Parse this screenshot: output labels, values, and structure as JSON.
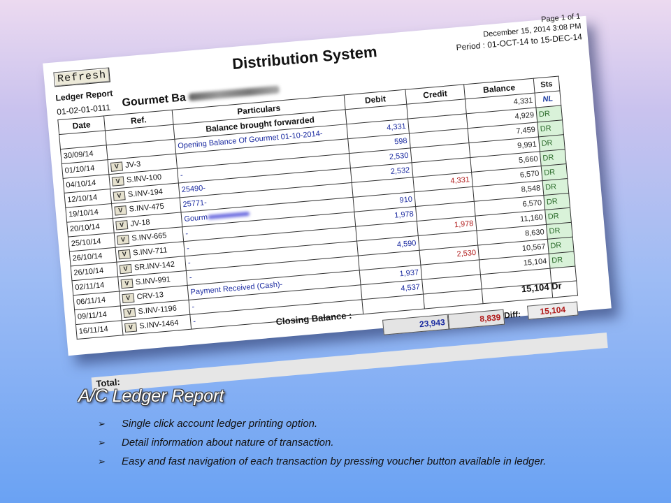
{
  "report": {
    "refresh_label": "Refresh",
    "title": "Distribution System",
    "page": "Page 1 of 1",
    "printed": "December 15, 2014 3:08 PM",
    "period": "Period : 01-OCT-14 to 15-DEC-14",
    "report_label": "Ledger Report",
    "account_code": "01-02-01-0111",
    "account_name": "Gourmet Ba",
    "columns": {
      "date": "Date",
      "ref": "Ref.",
      "particulars": "Particulars",
      "debit": "Debit",
      "credit": "Credit",
      "balance": "Balance",
      "sts": "Sts"
    },
    "opening": {
      "particulars": "Balance brought forwarded",
      "sts": "NL",
      "balance": "4,331",
      "sts2": "DR"
    },
    "rows": [
      {
        "date": "30/09/14",
        "voucher": "",
        "ref": "",
        "particulars": "Opening Balance Of Gourmet 01-10-2014-",
        "debit": "4,331",
        "credit": "",
        "balance": "4,929",
        "sts": "DR"
      },
      {
        "date": "01/10/14",
        "voucher": "V",
        "ref": "JV-3",
        "particulars": "",
        "debit": "598",
        "credit": "",
        "balance": "7,459",
        "sts": "DR"
      },
      {
        "date": "04/10/14",
        "voucher": "V",
        "ref": "S.INV-100",
        "particulars": "-",
        "debit": "2,530",
        "credit": "",
        "balance": "9,991",
        "sts": "DR"
      },
      {
        "date": "12/10/14",
        "voucher": "V",
        "ref": "S.INV-194",
        "particulars": "25490-",
        "debit": "2,532",
        "credit": "",
        "balance": "5,660",
        "sts": "DR"
      },
      {
        "date": "19/10/14",
        "voucher": "V",
        "ref": "S.INV-475",
        "particulars": "25771-",
        "debit": "",
        "credit": "4,331",
        "balance": "6,570",
        "sts": "DR"
      },
      {
        "date": "20/10/14",
        "voucher": "V",
        "ref": "JV-18",
        "particulars": "Gourm",
        "debit": "910",
        "credit": "",
        "balance": "8,548",
        "sts": "DR"
      },
      {
        "date": "25/10/14",
        "voucher": "V",
        "ref": "S.INV-665",
        "particulars": "-",
        "debit": "1,978",
        "credit": "",
        "balance": "6,570",
        "sts": "DR"
      },
      {
        "date": "26/10/14",
        "voucher": "V",
        "ref": "S.INV-711",
        "particulars": "-",
        "debit": "",
        "credit": "1,978",
        "balance": "11,160",
        "sts": "DR"
      },
      {
        "date": "26/10/14",
        "voucher": "V",
        "ref": "SR.INV-142",
        "particulars": "-",
        "debit": "4,590",
        "credit": "",
        "balance": "8,630",
        "sts": "DR"
      },
      {
        "date": "02/11/14",
        "voucher": "V",
        "ref": "S.INV-991",
        "particulars": "-",
        "debit": "",
        "credit": "2,530",
        "balance": "10,567",
        "sts": "DR"
      },
      {
        "date": "06/11/14",
        "voucher": "V",
        "ref": "CRV-13",
        "particulars": "Payment Received (Cash)-",
        "debit": "1,937",
        "credit": "",
        "balance": "15,104",
        "sts": "DR"
      },
      {
        "date": "09/11/14",
        "voucher": "V",
        "ref": "S.INV-1196",
        "particulars": "-",
        "debit": "4,537",
        "credit": "",
        "balance": "",
        "sts": ""
      },
      {
        "date": "16/11/14",
        "voucher": "V",
        "ref": "S.INV-1464",
        "particulars": "-",
        "debit": "",
        "credit": "",
        "balance": "",
        "sts": ""
      }
    ],
    "closing_label": "Closing Balance :",
    "closing_value": "15,104  Dr",
    "total_debit": "23,943",
    "total_credit": "8,839",
    "diff_label": "Diff:",
    "diff_value": "15,104",
    "total_label": "Total:"
  },
  "slide": {
    "heading": "A/C Ledger Report",
    "bullet_glyph": "➢",
    "bullets": [
      "Single click account ledger printing option.",
      "Detail information about nature of transaction.",
      "Easy and fast navigation of each transaction by pressing voucher button available in ledger."
    ]
  }
}
